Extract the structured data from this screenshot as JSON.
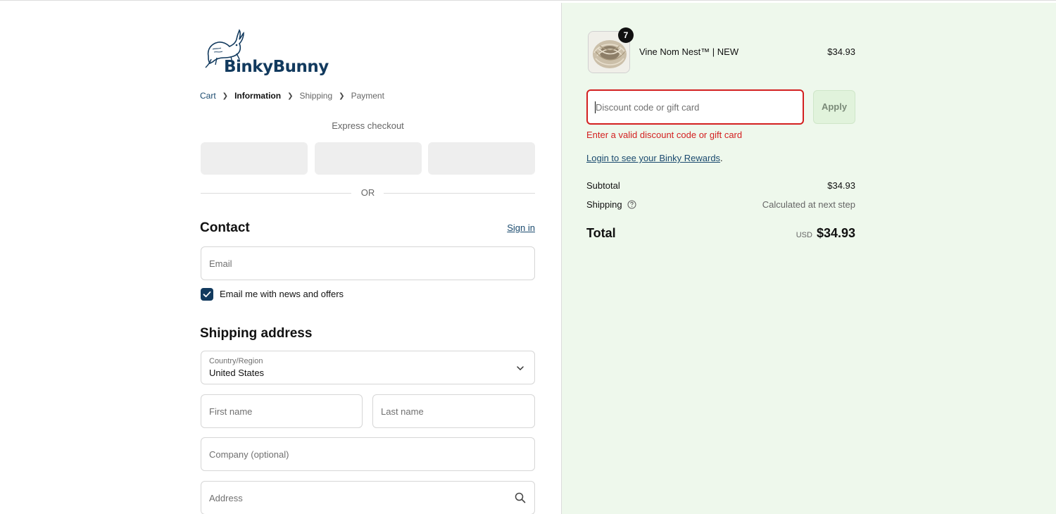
{
  "brand": {
    "name": "BinkyBunny"
  },
  "breadcrumb": [
    {
      "label": "Cart",
      "state": "link"
    },
    {
      "label": "Information",
      "state": "active"
    },
    {
      "label": "Shipping",
      "state": "inactive"
    },
    {
      "label": "Payment",
      "state": "inactive"
    }
  ],
  "express": {
    "label": "Express checkout",
    "divider": "OR"
  },
  "contact": {
    "title": "Contact",
    "signin": "Sign in",
    "email_placeholder": "Email",
    "newsletter_label": "Email me with news and offers",
    "newsletter_checked": true
  },
  "shipping": {
    "title": "Shipping address",
    "country_label": "Country/Region",
    "country_value": "United States",
    "first_name_placeholder": "First name",
    "last_name_placeholder": "Last name",
    "company_placeholder": "Company (optional)",
    "address_placeholder": "Address"
  },
  "order": {
    "item": {
      "name": "Vine Nom Nest™ | NEW",
      "price": "$34.93",
      "quantity": "7"
    },
    "discount": {
      "placeholder": "Discount code or gift card",
      "apply_label": "Apply",
      "error": "Enter a valid discount code or gift card"
    },
    "rewards_link": "Login to see your Binky Rewards",
    "rewards_suffix": ".",
    "subtotal_label": "Subtotal",
    "subtotal_value": "$34.93",
    "shipping_label": "Shipping",
    "shipping_value": "Calculated at next step",
    "total_label": "Total",
    "total_currency": "USD",
    "total_value": "$34.93"
  },
  "colors": {
    "brand_navy": "#123a5e",
    "error_red": "#d32020",
    "summary_bg": "#eef8ec"
  }
}
